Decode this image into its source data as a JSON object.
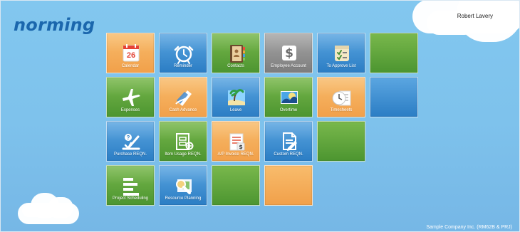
{
  "brand": "norming",
  "user": {
    "name": "Robert Lavery"
  },
  "footer": "Sample Company Inc. (RM62B & PRJ)",
  "icons": {
    "calendar": "calendar-icon",
    "reminder": "alarm-clock-icon",
    "contacts": "address-book-icon",
    "employee_account": "dollar-icon",
    "to_approve_list": "approval-list-icon",
    "expenses": "airplane-icon",
    "cash_advance": "cash-advance-icon",
    "leave": "beach-icon",
    "overtime": "overtime-icon",
    "timesheets": "timesheets-icon",
    "purchase_reqn": "purchase-request-icon",
    "item_usage_reqn": "item-usage-icon",
    "ap_invoice_reqn": "invoice-icon",
    "custom_reqn": "custom-request-icon",
    "project_scheduling": "project-scheduling-icon",
    "resource_planning": "resource-planning-icon"
  },
  "calendar": {
    "day": "26"
  },
  "tiles": {
    "calendar": "Calendar",
    "reminder": "Reminder",
    "contacts": "Contacts",
    "employee_account": "Employee Account",
    "to_approve_list": "To Approve List",
    "expenses": "Expenses",
    "cash_advance": "Cash Advance",
    "leave": "Leave",
    "overtime": "Overtime",
    "timesheets": "Timesheets",
    "purchase_reqn": "Purchase REQN.",
    "item_usage_reqn": "Item Usage REQN.",
    "ap_invoice_reqn": "A/P Invoice REQN.",
    "custom_reqn": "Custom REQN.",
    "project_scheduling": "Project Scheduling",
    "resource_planning": "Resource Planning"
  },
  "colors": {
    "background": "#80c4ee",
    "brand": "#1b67ad",
    "orange_tile": "#f3a751",
    "blue_tile": "#3b8fd3",
    "green_tile": "#5aa13a",
    "gray_tile": "#8f8f8f",
    "white": "#ffffff"
  }
}
